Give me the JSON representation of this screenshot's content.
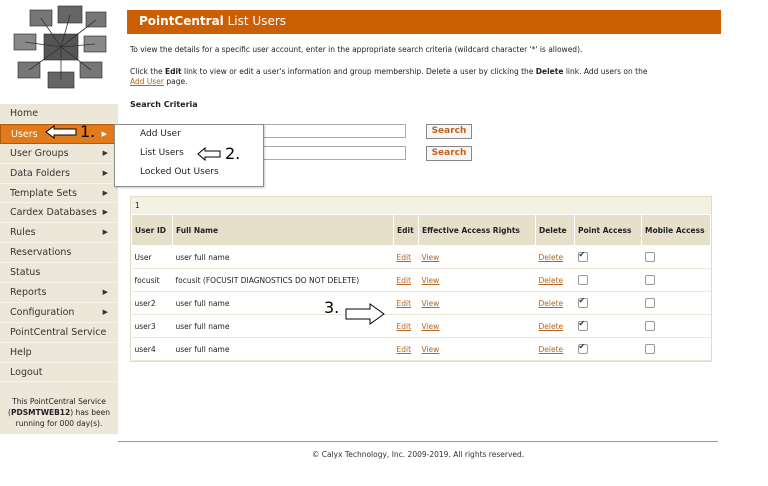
{
  "header": {
    "title_bold": "PointCentral",
    "title_rest": " List Users"
  },
  "intro": {
    "line1": "To view the details for a specific user account, enter in the appropriate search criteria (wildcard character '*' is allowed).",
    "line2_a": "Click the ",
    "line2_edit": "Edit",
    "line2_b": " link to view or edit a user's information and group membership. Delete a user by clicking the ",
    "line2_delete": "Delete",
    "line2_c": " link. Add users on the",
    "line3_link": "Add User",
    "line3_rest": " page."
  },
  "search": {
    "title": "Search Criteria",
    "button1": "Search",
    "button2": "Search"
  },
  "sidebar": {
    "items": [
      {
        "label": "Home",
        "arrow": ""
      },
      {
        "label": "Users",
        "arrow": "▶"
      },
      {
        "label": "User Groups",
        "arrow": "▶"
      },
      {
        "label": "Data Folders",
        "arrow": "▶"
      },
      {
        "label": "Template Sets",
        "arrow": "▶"
      },
      {
        "label": "Cardex Databases",
        "arrow": "▶"
      },
      {
        "label": "Rules",
        "arrow": "▶"
      },
      {
        "label": "Reservations",
        "arrow": ""
      },
      {
        "label": "Status",
        "arrow": ""
      },
      {
        "label": "Reports",
        "arrow": "▶"
      },
      {
        "label": "Configuration",
        "arrow": "▶"
      },
      {
        "label": "PointCentral Service",
        "arrow": ""
      },
      {
        "label": "Help",
        "arrow": ""
      },
      {
        "label": "Logout",
        "arrow": ""
      }
    ],
    "status_line1": "This PointCentral Service",
    "status_host": "PDSMTWEB12",
    "status_line2_rest": ") has been",
    "status_line3": "running for 000 day(s)."
  },
  "submenu": {
    "items": [
      "Add User",
      "List Users",
      "Locked Out Users"
    ]
  },
  "annotations": {
    "a1": "1.",
    "a2": "2.",
    "a3": "3."
  },
  "table": {
    "count": "1",
    "headers": [
      "User ID",
      "Full Name",
      "Edit",
      "Effective Access Rights",
      "Delete",
      "Point Access",
      "Mobile Access"
    ],
    "rows": [
      {
        "id": "User",
        "name": "user full name",
        "edit": "Edit",
        "view": "View",
        "delete": "Delete",
        "point": true,
        "mobile": false
      },
      {
        "id": "focusit",
        "name": "focusit (FOCUSIT DIAGNOSTICS DO NOT DELETE)",
        "edit": "Edit",
        "view": "View",
        "delete": "Delete",
        "point": false,
        "mobile": false
      },
      {
        "id": "user2",
        "name": "user full name",
        "edit": "Edit",
        "view": "View",
        "delete": "Delete",
        "point": true,
        "mobile": false
      },
      {
        "id": "user3",
        "name": "user full name",
        "edit": "Edit",
        "view": "View",
        "delete": "Delete",
        "point": true,
        "mobile": false
      },
      {
        "id": "user4",
        "name": "user full name",
        "edit": "Edit",
        "view": "View",
        "delete": "Delete",
        "point": true,
        "mobile": false
      }
    ]
  },
  "footer": {
    "text": "© Calyx Technology, Inc. 2009-2019. All rights reserved."
  }
}
